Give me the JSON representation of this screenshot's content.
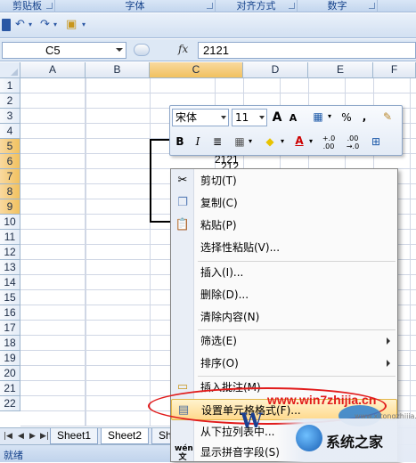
{
  "ribbon": {
    "groups": [
      "剪贴板",
      "字体",
      "对齐方式",
      "数字"
    ]
  },
  "formula_bar": {
    "name_box": "C5",
    "fx_label": "fx",
    "formula": "2121"
  },
  "grid": {
    "columns": [
      "A",
      "B",
      "C",
      "D",
      "E",
      "F"
    ],
    "selected_column": "C",
    "rows": [
      "1",
      "2",
      "3",
      "4",
      "5",
      "6",
      "7",
      "8",
      "9",
      "10",
      "11",
      "12",
      "13",
      "14",
      "15",
      "16",
      "17",
      "18",
      "19",
      "20",
      "21",
      "22"
    ],
    "selected_rows": [
      "5",
      "6",
      "7",
      "8",
      "9"
    ],
    "cells": {
      "c5": "2121",
      "c6": "212"
    }
  },
  "mini_toolbar": {
    "font_name": "宋体",
    "font_size": "11",
    "grow_font": "A",
    "shrink_font": "A",
    "percent": "%",
    "comma": ",",
    "bold": "B",
    "italic": "I",
    "font_color_letter": "A",
    "inc_decimal": "+.0 .00",
    "dec_decimal": ".00 →.0"
  },
  "context_menu": {
    "items": [
      {
        "label": "剪切(T)",
        "icon": "scissors-icon"
      },
      {
        "label": "复制(C)",
        "icon": "copy-icon"
      },
      {
        "label": "粘贴(P)",
        "icon": "paste-icon"
      },
      {
        "label": "选择性粘贴(V)...",
        "icon": ""
      },
      {
        "label": "插入(I)...",
        "icon": ""
      },
      {
        "label": "删除(D)...",
        "icon": ""
      },
      {
        "label": "清除内容(N)",
        "icon": ""
      },
      {
        "label": "筛选(E)",
        "icon": ""
      },
      {
        "label": "排序(O)",
        "icon": ""
      },
      {
        "label": "插入批注(M)",
        "icon": "comment-icon"
      },
      {
        "label": "设置单元格格式(F)...",
        "icon": "format-cells-icon"
      },
      {
        "label": "从下拉列表中...",
        "icon": ""
      },
      {
        "label": "显示拼音字段(S)",
        "icon": "phonetic-icon"
      }
    ]
  },
  "sheets": {
    "tabs": [
      "Sheet1",
      "Sheet2",
      "Sh"
    ],
    "active": "Sheet2"
  },
  "status": {
    "text": "就绪"
  },
  "watermark": {
    "url": "www.win7zhijia.cn",
    "logo_text": "系统之家",
    "small_url": "www.xitongzhijia.net",
    "w_letter": "W"
  },
  "colors": {
    "highlight_fill": "#ffd98c",
    "selected_header": "#f1c15f",
    "watermark_red": "#e11b1b"
  }
}
